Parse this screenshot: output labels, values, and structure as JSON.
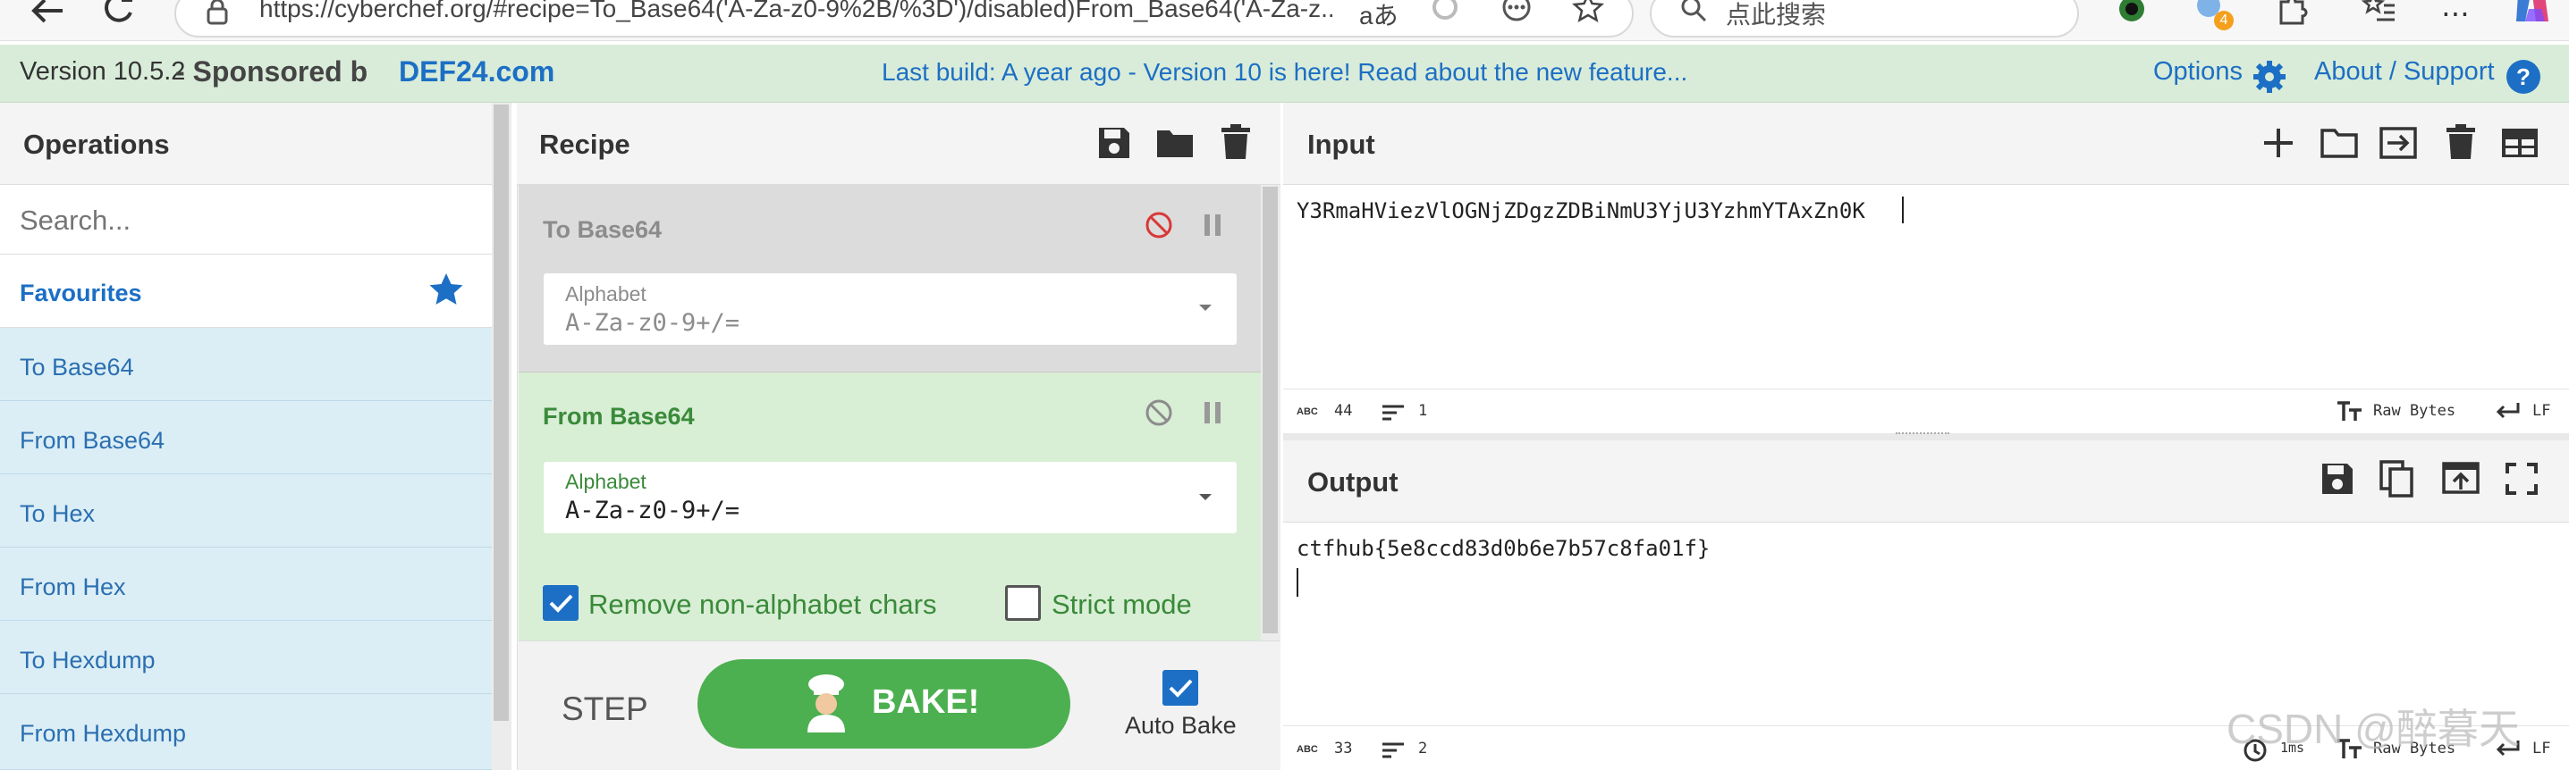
{
  "browser": {
    "url": "https://cyberchef.org/#recipe=To_Base64('A-Za-z0-9%2B/%3D')/disabled)From_Base64('A-Za-z...",
    "search_placeholder": "点此搜索",
    "extension_badge": "4"
  },
  "banner": {
    "version": "Version 10.5.2",
    "sponsored": " - Sponsored b",
    "sponsor": "DEF24.com",
    "last_build": "Last build: A year ago - Version 10 is here! Read about the new feature...",
    "options": "Options",
    "about": "About / Support"
  },
  "operations": {
    "title": "Operations",
    "search_placeholder": "Search...",
    "favourites": "Favourites",
    "items": [
      "To Base64",
      "From Base64",
      "To Hex",
      "From Hex",
      "To Hexdump",
      "From Hexdump"
    ]
  },
  "recipe": {
    "title": "Recipe",
    "ops": [
      {
        "name": "To Base64",
        "arg_label": "Alphabet",
        "arg_value": "A-Za-z0-9+/=",
        "state": "disabled"
      },
      {
        "name": "From Base64",
        "arg_label": "Alphabet",
        "arg_value": "A-Za-z0-9+/=",
        "state": "enabled",
        "checkbox1": "Remove non-alphabet chars",
        "checkbox1_checked": true,
        "checkbox2": "Strict mode",
        "checkbox2_checked": false
      }
    ],
    "step_label": "STEP",
    "bake_label": "BAKE!",
    "autobake_label": "Auto Bake",
    "autobake_checked": true
  },
  "input": {
    "title": "Input",
    "value": "Y3RmaHViezVlOGNjZDgzZDBiNmU3YjU3YzhmYTAxZn0K",
    "length": "44",
    "lines": "1",
    "encoding": "Raw Bytes",
    "eol": "LF"
  },
  "output": {
    "title": "Output",
    "value": "ctfhub{5e8ccd83d0b6e7b57c8fa01f}",
    "length": "33",
    "lines": "2",
    "time": "1ms",
    "encoding": "Raw Bytes",
    "eol": "LF"
  },
  "watermark": "CSDN @醉暮天",
  "colors": {
    "banner_bg": "#d9ecd9",
    "accent_blue": "#1c6fc4",
    "disabled_op_bg": "#dcdcdc",
    "enabled_op_bg": "#d8eed5",
    "enabled_green": "#3a8a3a",
    "bake_green": "#4caf50",
    "disable_red": "#d93838"
  }
}
